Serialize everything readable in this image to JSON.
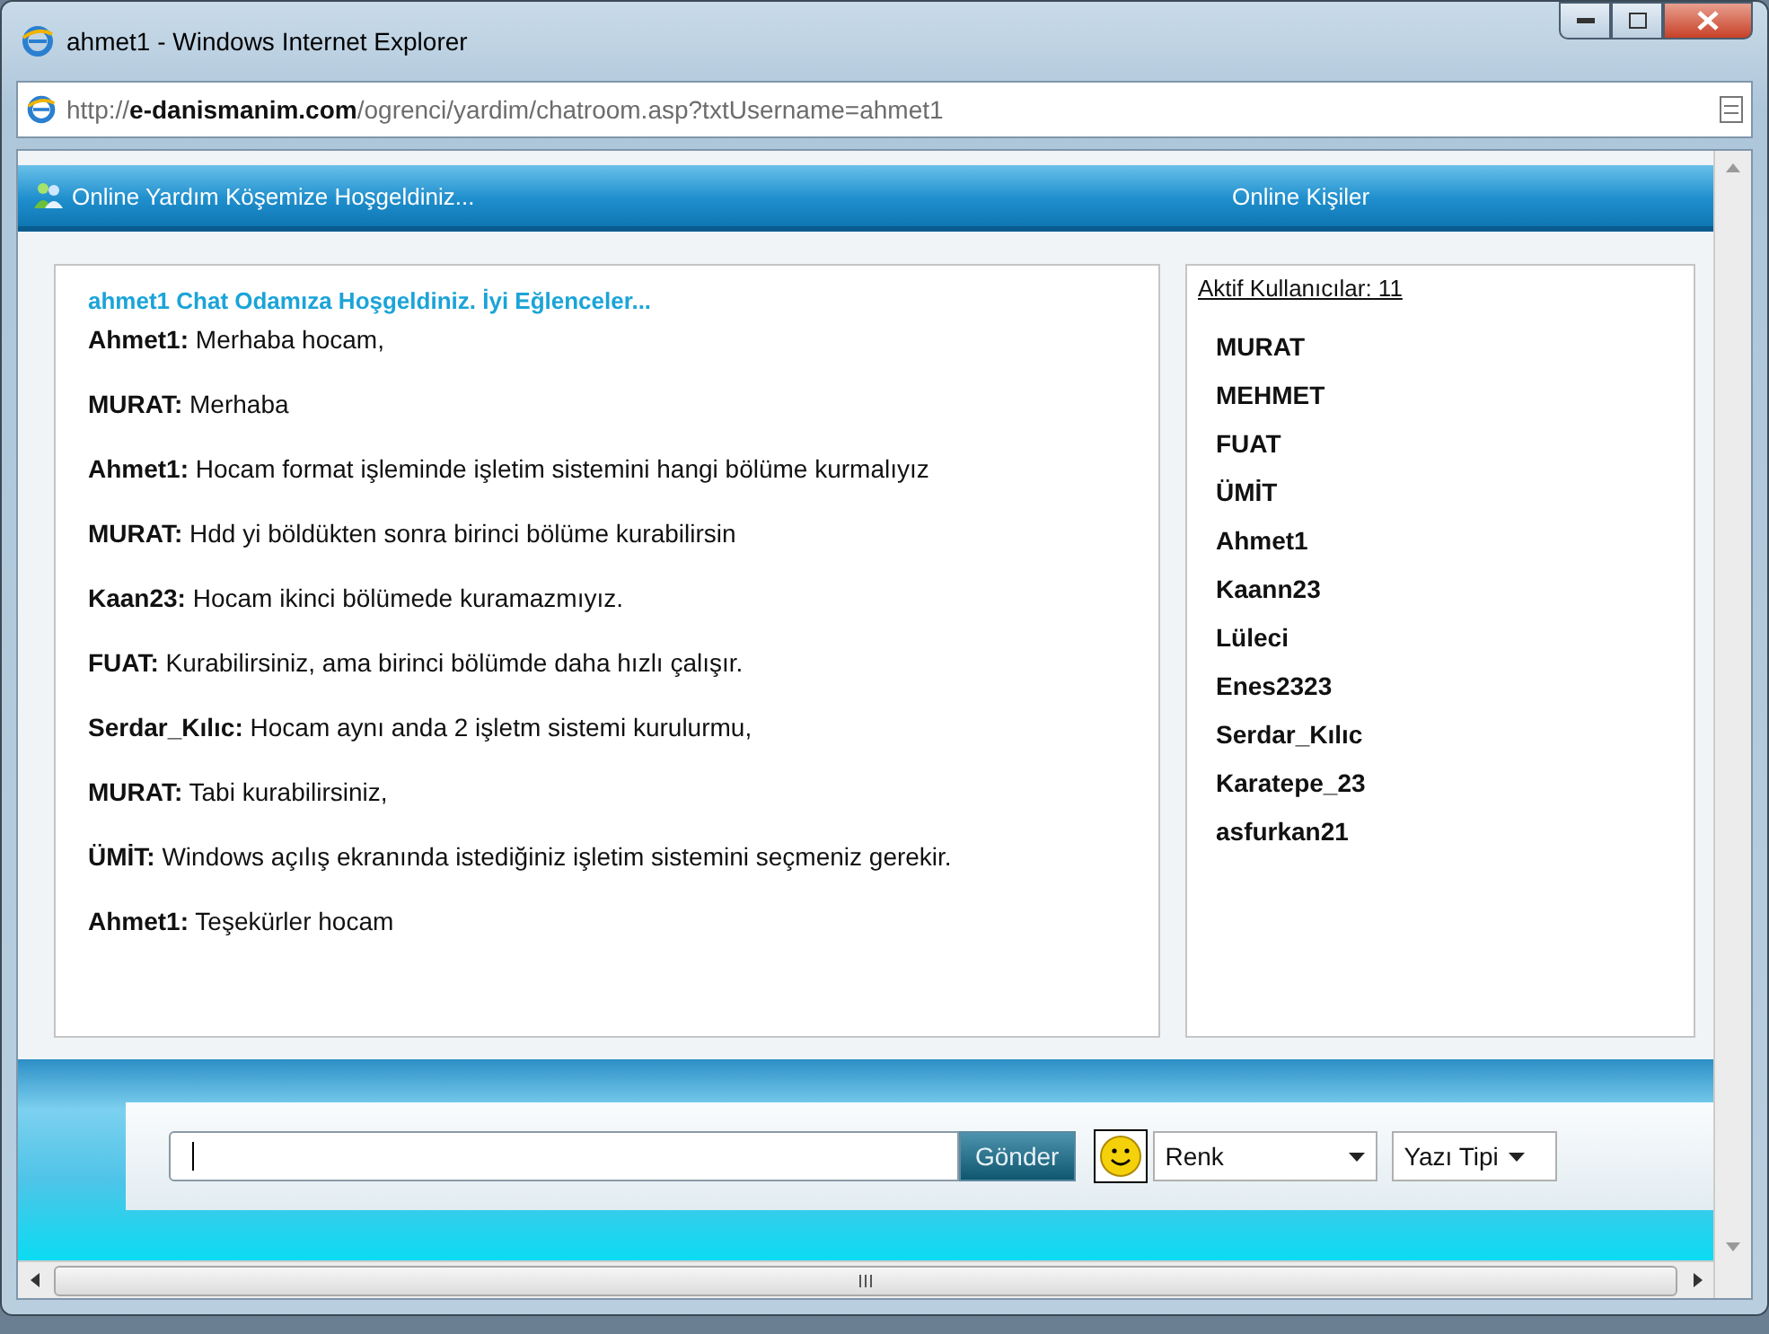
{
  "window": {
    "title": "ahmet1 - Windows Internet Explorer"
  },
  "address_bar": {
    "url": "http://**e-danismanim.com**/ogrenci/yardim/chatroom.asp?txtUsername=ahmet1"
  },
  "header": {
    "title": "Online Yardım Köşemize Hoşgeldiniz...",
    "side_title": "Online Kişiler"
  },
  "chat": {
    "welcome": "ahmet1 Chat Odamıza Hoşgeldiniz. İyi Eğlenceler...",
    "messages": [
      {
        "sender": "Ahmet1:",
        "text": "Merhaba hocam,"
      },
      {
        "sender": "MURAT:",
        "text": "Merhaba"
      },
      {
        "sender": "Ahmet1:",
        "text": "Hocam format işleminde işletim sistemini hangi bölüme kurmalıyız"
      },
      {
        "sender": "MURAT:",
        "text": "Hdd yi böldükten sonra birinci bölüme kurabilirsin"
      },
      {
        "sender": "Kaan23:",
        "text": "Hocam ikinci bölümede kuramazmıyız."
      },
      {
        "sender": "FUAT:",
        "text": "Kurabilirsiniz, ama birinci bölümde daha hızlı çalışır."
      },
      {
        "sender": "Serdar_Kılıc:",
        "text": "Hocam aynı anda 2 işletm sistemi kurulurmu,"
      },
      {
        "sender": "MURAT:",
        "text": "Tabi kurabilirsiniz,"
      },
      {
        "sender": "ÜMİT:",
        "text": "Windows açılış ekranında istediğiniz işletim sistemini seçmeniz gerekir."
      },
      {
        "sender": "Ahmet1:",
        "text": "Teşekürler hocam"
      }
    ]
  },
  "users": {
    "heading": "Aktif Kullanıcılar: 11",
    "items": [
      "MURAT",
      "MEHMET",
      "FUAT",
      "ÜMİT",
      "Ahmet1",
      "Kaann23",
      "Lüleci",
      "Enes2323",
      "Serdar_Kılıc",
      "Karatepe_23",
      "asfurkan21"
    ]
  },
  "compose": {
    "send_button": "Gönder",
    "color_select": "Renk",
    "font_select": "Yazı Tipi"
  }
}
